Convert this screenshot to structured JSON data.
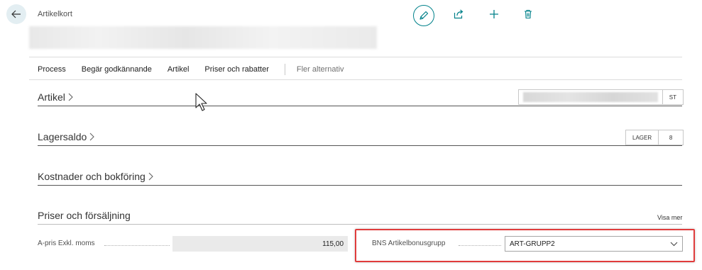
{
  "header": {
    "page_type": "Artikelkort"
  },
  "toolbar": {
    "edit_icon": "pencil-icon",
    "share_icon": "share-icon",
    "new_icon": "plus-icon",
    "delete_icon": "trash-icon",
    "accent_color": "#00818a"
  },
  "menu": {
    "items": [
      {
        "label": "Process"
      },
      {
        "label": "Begär godkännande"
      },
      {
        "label": "Artikel"
      },
      {
        "label": "Priser och rabatter"
      }
    ],
    "more": "Fler alternativ"
  },
  "sections": {
    "artikel": {
      "title": "Artikel",
      "fact_unit": "ST"
    },
    "lagersaldo": {
      "title": "Lagersaldo",
      "fact_label": "LAGER",
      "fact_value": "8"
    },
    "kostnader": {
      "title": "Kostnader och bokföring"
    },
    "priser": {
      "title": "Priser och försäljning",
      "show_more": "Visa mer",
      "fields": {
        "unit_price_label": "A-pris Exkl. moms",
        "unit_price_value": "115,00",
        "bonus_group_label": "BNS Artikelbonusgrupp",
        "bonus_group_value": "ART-GRUPP2"
      }
    }
  },
  "highlight_color": "#e03c3c"
}
